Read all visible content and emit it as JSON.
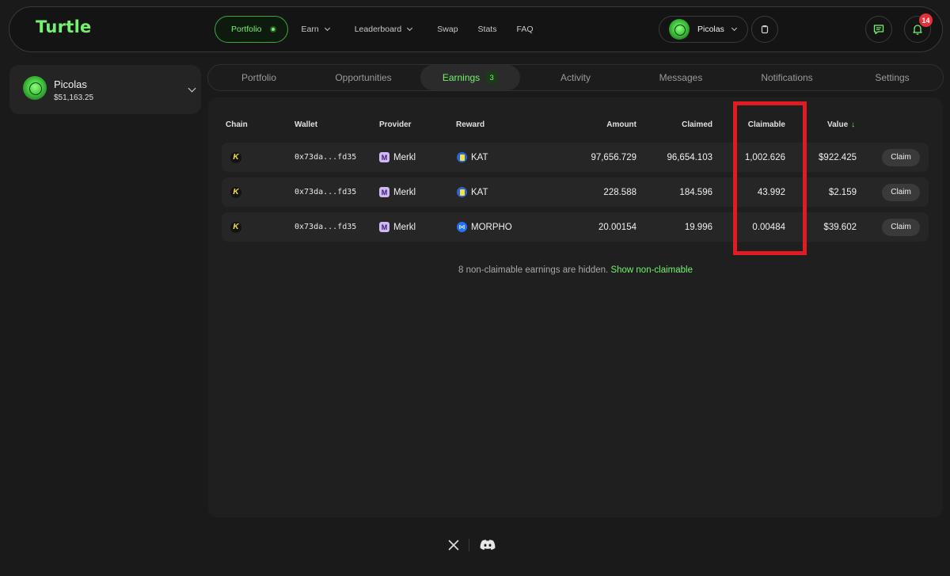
{
  "app": {
    "logo": "Turtle"
  },
  "nav": {
    "portfolio": "Portfolio",
    "earn": "Earn",
    "leaderboard": "Leaderboard",
    "swap": "Swap",
    "stats": "Stats",
    "faq": "FAQ"
  },
  "user": {
    "name": "Picolas",
    "balance": "$51,163.25"
  },
  "notifications": {
    "count": "14"
  },
  "tabs": [
    {
      "label": "Portfolio"
    },
    {
      "label": "Opportunities"
    },
    {
      "label": "Earnings",
      "count": "3"
    },
    {
      "label": "Activity"
    },
    {
      "label": "Messages"
    },
    {
      "label": "Notifications"
    },
    {
      "label": "Settings"
    }
  ],
  "table": {
    "headers": {
      "chain": "Chain",
      "wallet": "Wallet",
      "provider": "Provider",
      "reward": "Reward",
      "amount": "Amount",
      "claimed": "Claimed",
      "claimable": "Claimable",
      "value": "Value"
    },
    "rows": [
      {
        "chain": "K",
        "wallet": "0x73da...fd35",
        "provider": "Merkl",
        "reward": "KAT",
        "amount": "97,656.729",
        "claimed": "96,654.103",
        "claimable": "1,002.626",
        "value": "$922.425",
        "action": "Claim"
      },
      {
        "chain": "K",
        "wallet": "0x73da...fd35",
        "provider": "Merkl",
        "reward": "KAT",
        "amount": "228.588",
        "claimed": "184.596",
        "claimable": "43.992",
        "value": "$2.159",
        "action": "Claim"
      },
      {
        "chain": "K",
        "wallet": "0x73da...fd35",
        "provider": "Merkl",
        "reward": "MORPHO",
        "amount": "20.00154",
        "claimed": "19.996",
        "claimable": "0.00484",
        "value": "$39.602",
        "action": "Claim"
      }
    ]
  },
  "hidden_note": {
    "text": "8 non-claimable earnings are hidden.",
    "link": "Show non-claimable"
  },
  "colors": {
    "accent": "#73f36c",
    "highlight": "#e11b22",
    "badge": "#e5303a"
  },
  "icons": {
    "header": [
      "chat-icon",
      "bell-icon",
      "clipboard-icon"
    ],
    "footer": [
      "x-icon",
      "discord-icon"
    ]
  }
}
